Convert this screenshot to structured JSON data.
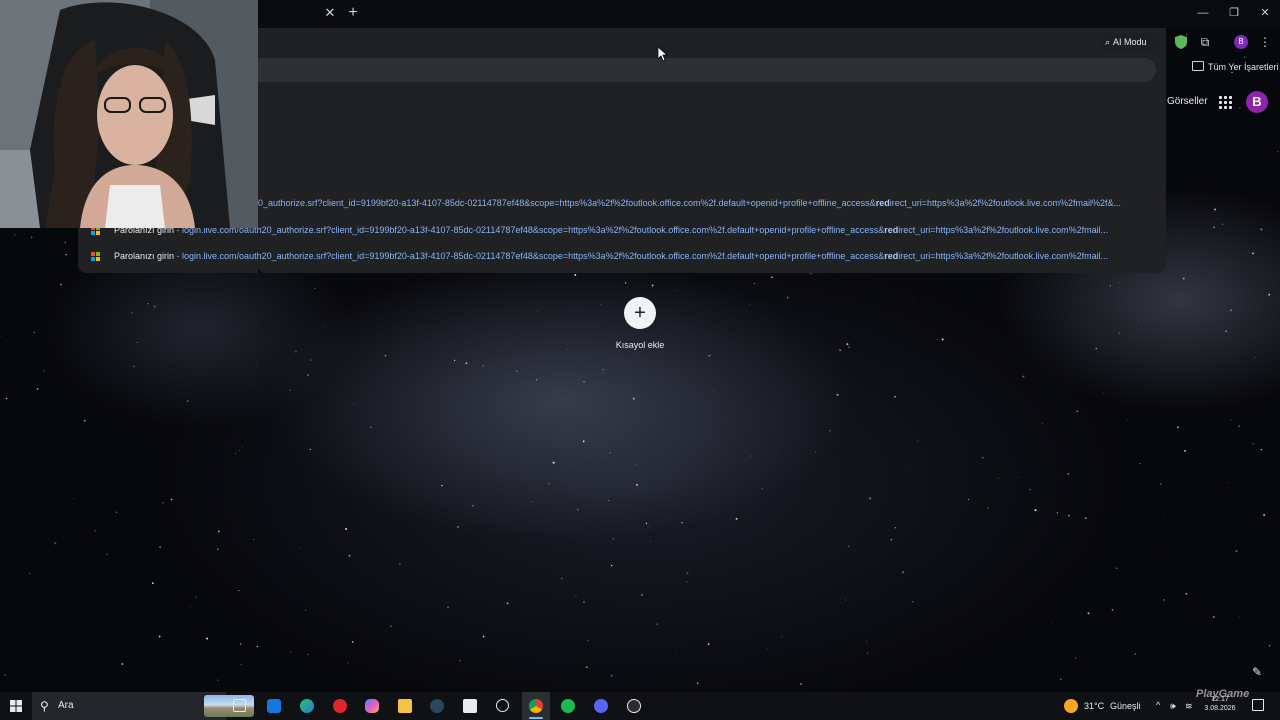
{
  "browser": {
    "ai_mode_label": "AI Modu",
    "profile_initial_small": "B",
    "bookmarks_label": "Tüm Yer İşaretleri"
  },
  "omnibox": {
    "suggestions": [
      {
        "title": "",
        "url_pre": "0_authorize.srf?client_id=9199bf20-a13f-4107-85dc-02114787ef48&scope=https%3a%2f%2foutlook.office.com%2f.default+openid+profile+offline_access&",
        "url_bold": "red",
        "url_post": "irect_uri=https%3a%2f%2foutlook.live.com%2fmail%2f&..."
      },
      {
        "title": "Parolanızı girin",
        "url_pre": "login.live.com/oauth20_authorize.srf?client_id=9199bf20-a13f-4107-85dc-02114787ef48&scope=https%3a%2f%2foutlook.office.com%2f.default+openid+profile+offline_access&",
        "url_bold": "red",
        "url_post": "irect_uri=https%3a%2f%2foutlook.live.com%2fmail..."
      },
      {
        "title": "Parolanızı girin",
        "url_pre": "login.live.com/oauth20_authorize.srf?client_id=9199bf20-a13f-4107-85dc-02114787ef48&scope=https%3a%2f%2foutlook.office.com%2f.default+openid+profile+offline_access&",
        "url_bold": "red",
        "url_post": "irect_uri=https%3a%2f%2foutlook.live.com%2fmail..."
      }
    ]
  },
  "ntp": {
    "images_label": "Görseller",
    "avatar_initial": "B",
    "add_shortcut_label": "Kısayol ekle",
    "add_shortcut_symbol": "+"
  },
  "taskbar": {
    "search_placeholder": "Ara",
    "weather_temp": "31°C",
    "weather_desc": "Güneşli",
    "time": "12:17",
    "date": "3.08.2026"
  },
  "overlay": {
    "watermark_text": "PlayGame"
  }
}
